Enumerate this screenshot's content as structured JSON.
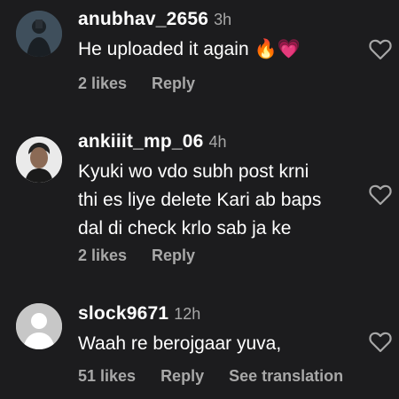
{
  "comments": [
    {
      "username": "anubhav_2656",
      "time": "3h",
      "text": "He uploaded it again 🔥💗",
      "likes": "2 likes",
      "reply": "Reply"
    },
    {
      "username": "ankiiit_mp_06",
      "time": "4h",
      "text": "Kyuki wo vdo subh post krni\nthi es liye delete Kari ab baps\ndal di check krlo sab ja ke",
      "likes": "2 likes",
      "reply": "Reply"
    },
    {
      "username": "slock9671",
      "time": "12h",
      "text": "Waah re berojgaar yuva,",
      "likes": "51 likes",
      "reply": "Reply",
      "see_translation": "See translation"
    }
  ],
  "icons": {
    "like": "heart-outline-icon",
    "avatar_placeholder": "default-avatar-icon"
  },
  "colors": {
    "background": "#1c1c1e",
    "primary_text": "#ffffff",
    "secondary_text": "#a8a8a8"
  }
}
